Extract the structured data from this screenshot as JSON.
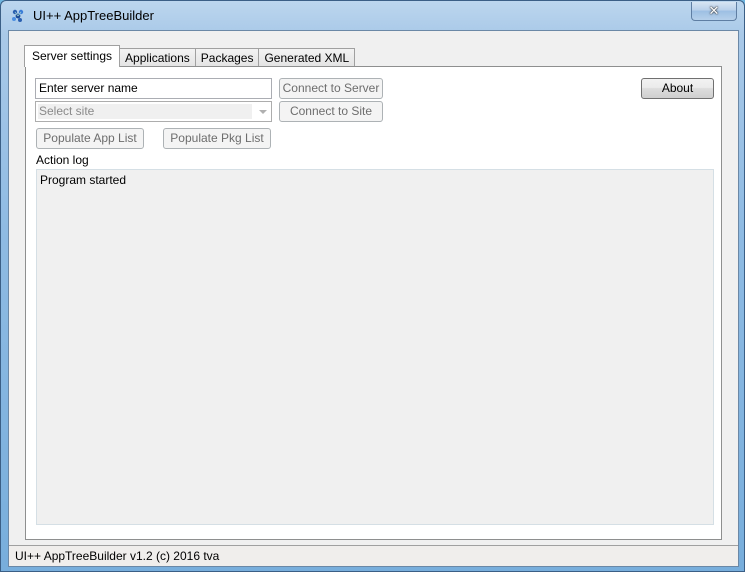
{
  "window": {
    "title": "UI++ AppTreeBuilder",
    "close_label": "✕"
  },
  "tabs": [
    {
      "label": "Server settings",
      "active": true
    },
    {
      "label": "Applications",
      "active": false
    },
    {
      "label": "Packages",
      "active": false
    },
    {
      "label": "Generated XML",
      "active": false
    }
  ],
  "server_settings": {
    "server_name_value": "Enter server name",
    "site_select_placeholder": "Select site",
    "connect_server_label": "Connect to Server",
    "connect_site_label": "Connect to Site",
    "about_label": "About",
    "populate_app_label": "Populate App List",
    "populate_pkg_label": "Populate Pkg List",
    "action_log_label": "Action log",
    "action_log_lines": [
      "Program started"
    ]
  },
  "statusbar": {
    "text": "UI++ AppTreeBuilder v1.2 (c) 2016 tva"
  }
}
